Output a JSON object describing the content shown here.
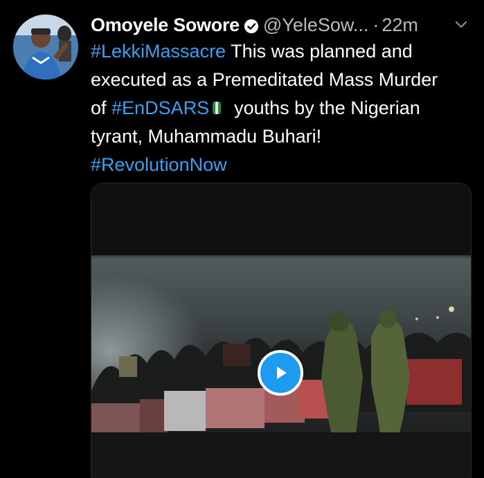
{
  "tweet": {
    "author": {
      "display_name": "Omoyele Sowore",
      "handle": "@YeleSow...",
      "verified": true,
      "avatar_icon": "profile-photo"
    },
    "separator": "·",
    "timestamp": "22m",
    "body": {
      "line1": {
        "hashtag": "#LekkiMassacre",
        "text": " This was planned and"
      },
      "line2": {
        "text": "executed as a Premeditated Mass Murder"
      },
      "line3": {
        "prefix": "of ",
        "hashtag": "#EnDSARS",
        "emoji": "nigeria-flag-emoji",
        "suffix": "youths by the Nigerian"
      },
      "line4": {
        "text": "tyrant, Muhammadu Buhari!"
      },
      "line5": {
        "hashtag": "#RevolutionNow"
      }
    },
    "media": {
      "type": "video",
      "play_icon": "play-icon"
    }
  },
  "colors": {
    "background": "#000000",
    "hashtag": "#3aa0f2",
    "text": "#ffffff",
    "secondary_text": "#b8bcc0",
    "play_button": "#1d9bf0"
  }
}
